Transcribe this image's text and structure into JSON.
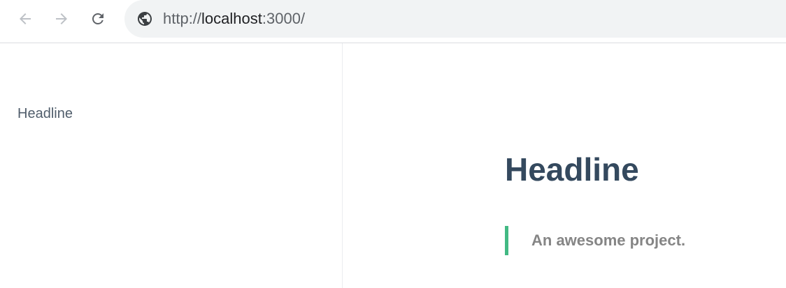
{
  "browser": {
    "url_scheme": "http://",
    "url_host": "localhost",
    "url_rest": ":3000/",
    "icons": {
      "back": "arrow-left-icon",
      "forward": "arrow-right-icon",
      "reload": "reload-icon",
      "site_info": "globe-icon"
    }
  },
  "sidebar": {
    "items": [
      {
        "label": "Headline"
      }
    ]
  },
  "main": {
    "heading": "Headline",
    "blockquote": "An awesome project."
  },
  "colors": {
    "accent": "#42b983",
    "heading": "#34495e",
    "sidebar_text": "#505d6b",
    "quote_text": "#858585"
  }
}
